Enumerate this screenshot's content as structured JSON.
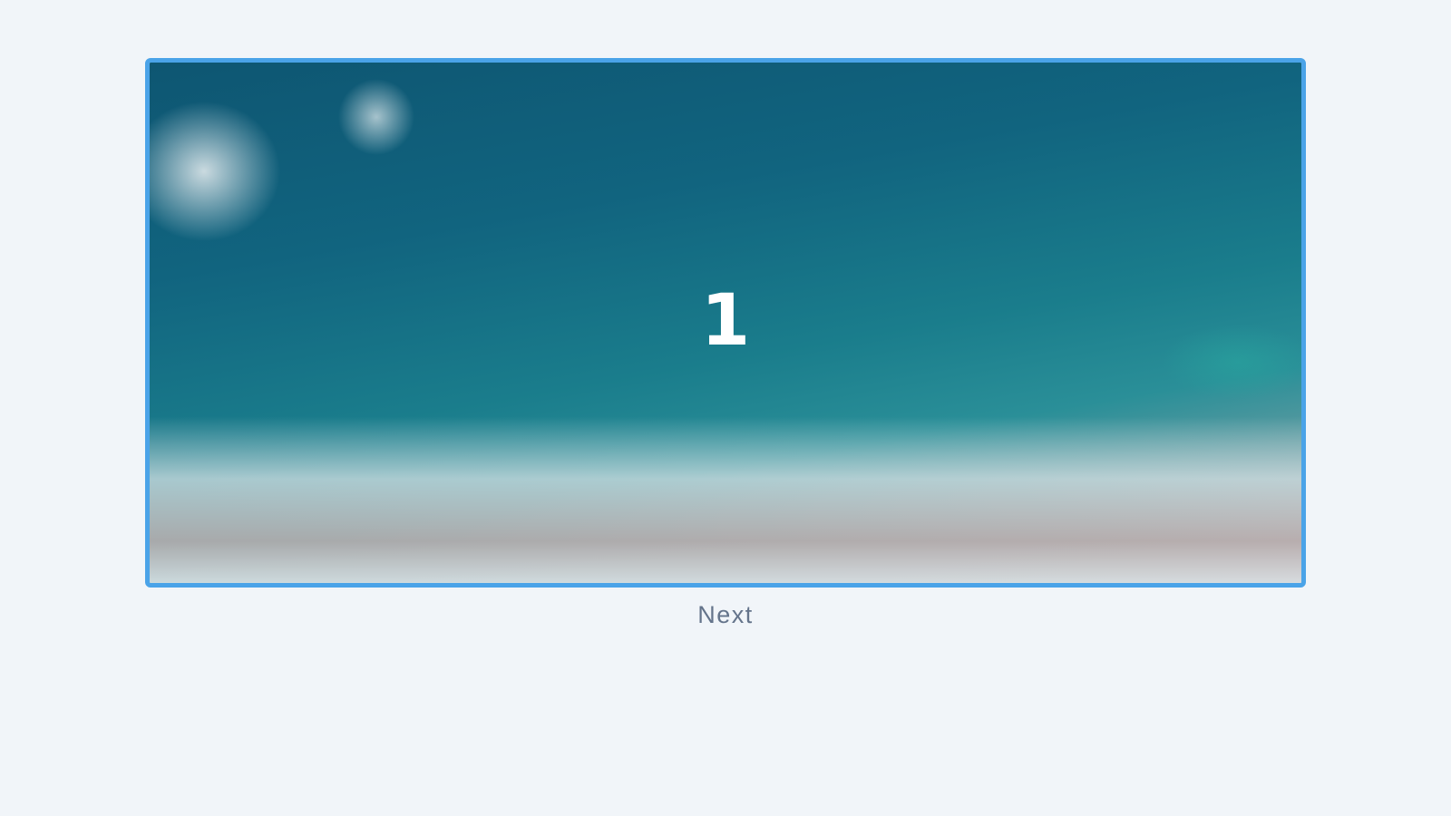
{
  "slider": {
    "current_slide": "1",
    "slide_image": "ocean-waves-aerial-photo",
    "border_color": "#4aa3e8",
    "next_label": "Next"
  }
}
